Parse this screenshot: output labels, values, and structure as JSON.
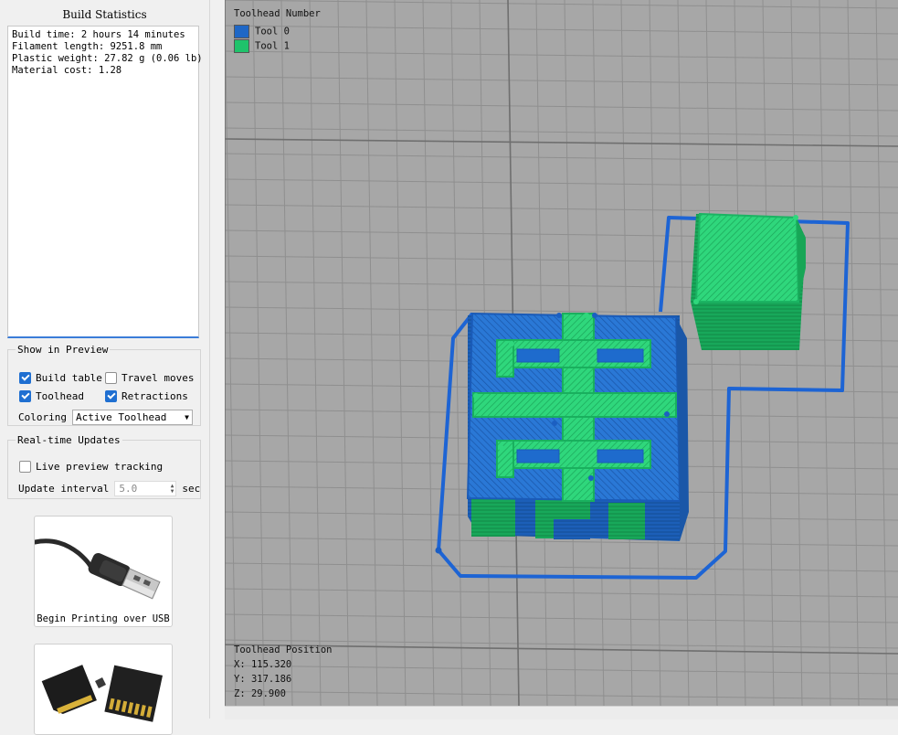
{
  "build_statistics": {
    "title": "Build Statistics",
    "lines": [
      "Build time: 2 hours 14 minutes",
      "Filament length: 9251.8 mm",
      "Plastic weight: 27.82 g (0.06 lb)",
      "Material cost: 1.28"
    ]
  },
  "show_in_preview": {
    "legend": "Show in Preview",
    "build_table": {
      "label": "Build table",
      "checked": true
    },
    "travel_moves": {
      "label": "Travel moves",
      "checked": false
    },
    "toolhead": {
      "label": "Toolhead",
      "checked": true
    },
    "retractions": {
      "label": "Retractions",
      "checked": true
    },
    "coloring_label": "Coloring",
    "coloring_value": "Active Toolhead"
  },
  "realtime_updates": {
    "legend": "Real-time Updates",
    "live_preview": {
      "label": "Live preview tracking",
      "checked": false
    },
    "interval_label": "Update interval",
    "interval_value": "5.0",
    "interval_unit": "sec"
  },
  "buttons": {
    "usb_label": "Begin Printing over USB",
    "sd_label": ""
  },
  "legend": {
    "title": "Toolhead Number",
    "tools": [
      {
        "label": "Tool 0",
        "color": "#1f67c6"
      },
      {
        "label": "Tool 1",
        "color": "#1fc36b"
      }
    ]
  },
  "toolhead_position": {
    "title": "Toolhead Position",
    "x": "X: 115.320",
    "y": "Y: 317.186",
    "z": "Z: 29.900"
  },
  "colors": {
    "accent": "#1f6fd1",
    "tool0": "#1f67c6",
    "tool1": "#1fc36b",
    "grid_bg": "#a7a7a7"
  }
}
